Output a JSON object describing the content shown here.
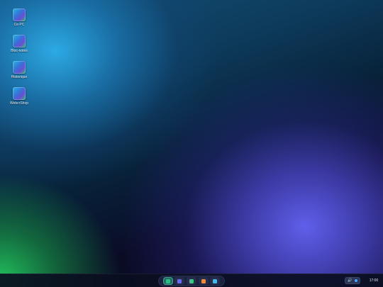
{
  "desktop": {
    "icons": [
      {
        "label": "Ce PC",
        "icon": "computer-icon"
      },
      {
        "label": "Bloc-notes",
        "icon": "notepad-icon"
      },
      {
        "label": "Historique",
        "icon": "history-icon"
      },
      {
        "label": "WebcrShop",
        "icon": "shop-icon"
      }
    ]
  },
  "taskbar": {
    "apps": [
      {
        "icon": "start-icon",
        "color": "#2bbf86",
        "active": true
      },
      {
        "icon": "app-violet-icon",
        "color": "#6a6cf0",
        "active": false
      },
      {
        "icon": "app-green-icon",
        "color": "#3fc48a",
        "active": false
      },
      {
        "icon": "app-orange-icon",
        "color": "#f08a3a",
        "active": false
      },
      {
        "icon": "app-blue-icon",
        "color": "#43b6ea",
        "active": false
      }
    ],
    "tray": {
      "volume_icon": "🔊",
      "network_icon": "network-icon"
    },
    "clock": "17:00"
  }
}
